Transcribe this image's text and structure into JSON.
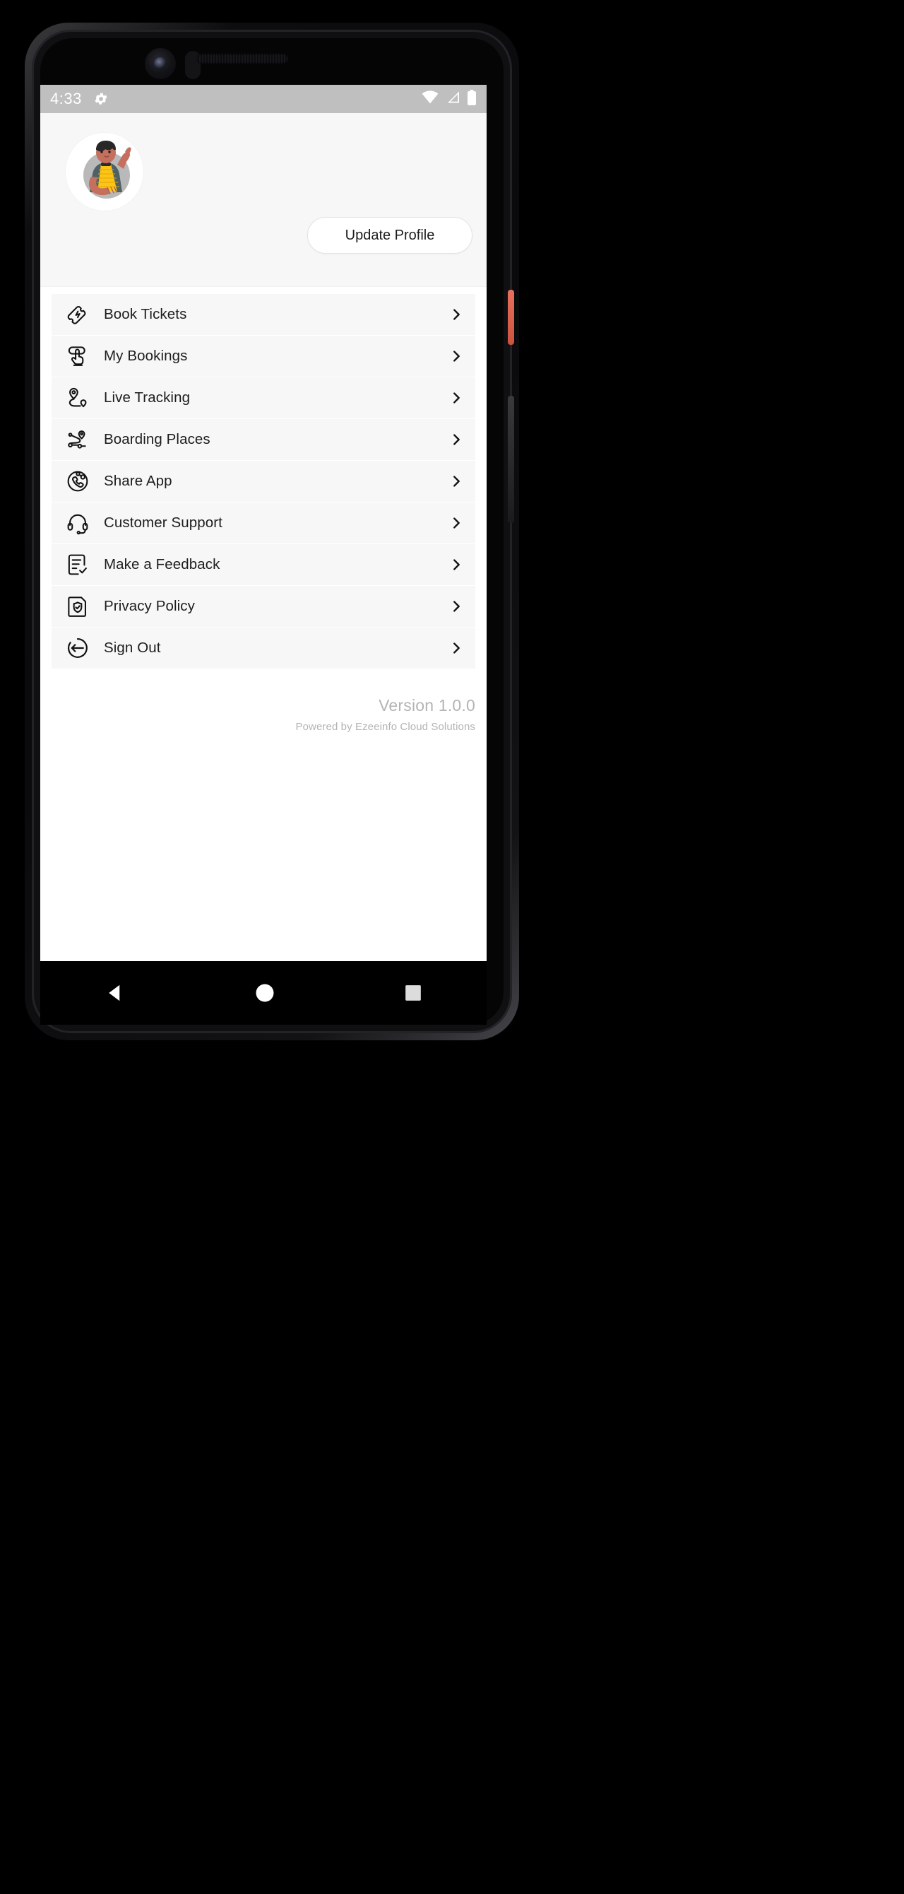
{
  "device": {
    "platform": "android-phone-mockup",
    "accent_button_color": "#e8705e"
  },
  "status_bar": {
    "time": "4:33",
    "settings_icon": "gear-icon",
    "icons": [
      "wifi-icon",
      "cellular-signal-icon",
      "battery-icon"
    ],
    "background": "#bfbfbf",
    "foreground": "#ffffff"
  },
  "profile": {
    "avatar": "waving-person-illustration-avatar",
    "update_button_label": "Update Profile",
    "card_background": "#f7f7f7"
  },
  "menu": {
    "items": [
      {
        "label": "Book Tickets",
        "icon": "ticket-icon",
        "chevron": "chevron-right-icon"
      },
      {
        "label": "My Bookings",
        "icon": "tap-booking-icon",
        "chevron": "chevron-right-icon"
      },
      {
        "label": "Live Tracking",
        "icon": "route-pin-icon",
        "chevron": "chevron-right-icon"
      },
      {
        "label": "Boarding Places",
        "icon": "boarding-route-icon",
        "chevron": "chevron-right-icon"
      },
      {
        "label": "Share App",
        "icon": "share-phone-icon",
        "chevron": "chevron-right-icon"
      },
      {
        "label": "Customer Support",
        "icon": "headset-icon",
        "chevron": "chevron-right-icon"
      },
      {
        "label": "Make a Feedback",
        "icon": "feedback-checklist-icon",
        "chevron": "chevron-right-icon"
      },
      {
        "label": "Privacy Policy",
        "icon": "shield-document-icon",
        "chevron": "chevron-right-icon"
      },
      {
        "label": "Sign Out",
        "icon": "sign-out-icon",
        "chevron": "chevron-right-icon"
      }
    ]
  },
  "footer": {
    "version": "Version 1.0.0",
    "powered_by": "Powered by Ezeeinfo Cloud Solutions",
    "text_color": "#b4b4b4"
  },
  "navigation_bar": {
    "back": "back-triangle-icon",
    "home": "home-circle-icon",
    "recents": "recents-square-icon"
  }
}
